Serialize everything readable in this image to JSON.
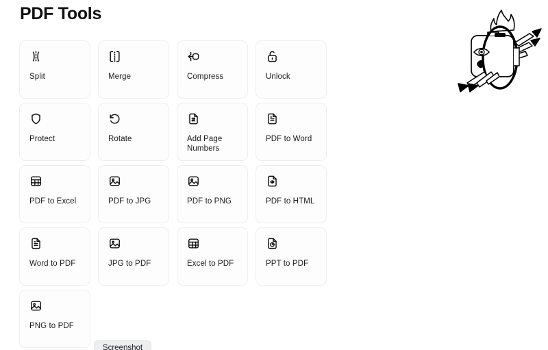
{
  "page": {
    "title": "PDF Tools",
    "background_color": "#ffffff",
    "text_color": "#111111",
    "card_background": "#fdfdfd",
    "card_border": "#efefef"
  },
  "tools": [
    {
      "label": "Split",
      "icon": "split-brackets-icon"
    },
    {
      "label": "Merge",
      "icon": "merge-dashed-rect-icon"
    },
    {
      "label": "Compress",
      "icon": "compress-arrows-icon"
    },
    {
      "label": "Unlock",
      "icon": "unlock-padlock-icon"
    },
    {
      "label": "Protect",
      "icon": "shield-icon"
    },
    {
      "label": "Rotate",
      "icon": "rotate-counterclockwise-icon"
    },
    {
      "label": "Add Page Numbers",
      "icon": "file-hash-icon"
    },
    {
      "label": "PDF to Word",
      "icon": "file-text-icon"
    },
    {
      "label": "PDF to Excel",
      "icon": "table-grid-icon"
    },
    {
      "label": "PDF to JPG",
      "icon": "image-icon"
    },
    {
      "label": "PDF to PNG",
      "icon": "image-icon"
    },
    {
      "label": "PDF to HTML",
      "icon": "file-code-icon"
    },
    {
      "label": "Word to PDF",
      "icon": "file-text-icon"
    },
    {
      "label": "JPG to PDF",
      "icon": "image-icon"
    },
    {
      "label": "Excel to PDF",
      "icon": "table-grid-icon"
    },
    {
      "label": "PPT to PDF",
      "icon": "file-chart-icon"
    },
    {
      "label": "PNG to PDF",
      "icon": "image-icon"
    }
  ],
  "mascot": {
    "name": "flame-ring-character-illustration",
    "stroke_color": "#000000",
    "fill_color": "#ffffff"
  },
  "screenshot_button": {
    "label": "Screenshot",
    "background_color": "#eceef0"
  }
}
